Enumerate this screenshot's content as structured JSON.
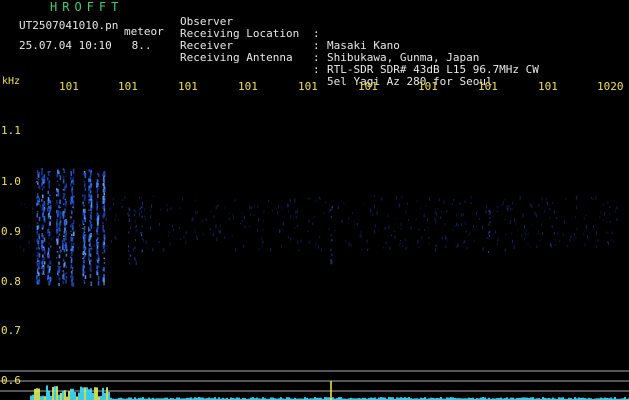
{
  "app_title": "HROFFT",
  "file_name": "UT2507041010.pn",
  "meteor_label": "meteor",
  "date_time": "25.07.04 10:10   8..",
  "header": {
    "rows": [
      {
        "key": "Observer",
        "value": "Masaki Kano"
      },
      {
        "key": "Receiving Location",
        "value": "Shibukawa, Gunma, Japan"
      },
      {
        "key": "Receiver",
        "value": "RTL-SDR SDR# 43dB L15 96.7MHz CW"
      },
      {
        "key": "Receiving Antenna",
        "value": "5el Yagi Az 280 for Seoul"
      }
    ],
    "separator": ":"
  },
  "freq_axis": {
    "unit": "kHz",
    "ticks": [
      "101",
      "101",
      "101",
      "101",
      "101",
      "101",
      "101",
      "101",
      "101",
      "1020"
    ]
  },
  "y_axis": {
    "labels": [
      "1.1",
      "1.0",
      "0.9",
      "0.8",
      "0.7",
      "0.6"
    ]
  },
  "colors": {
    "background": "#000000",
    "title_green": "#3ad06a",
    "tick_yellow": "#f0e050",
    "signal_blue": "#2a6dff",
    "histogram_cyan": "#40e0ff"
  }
}
